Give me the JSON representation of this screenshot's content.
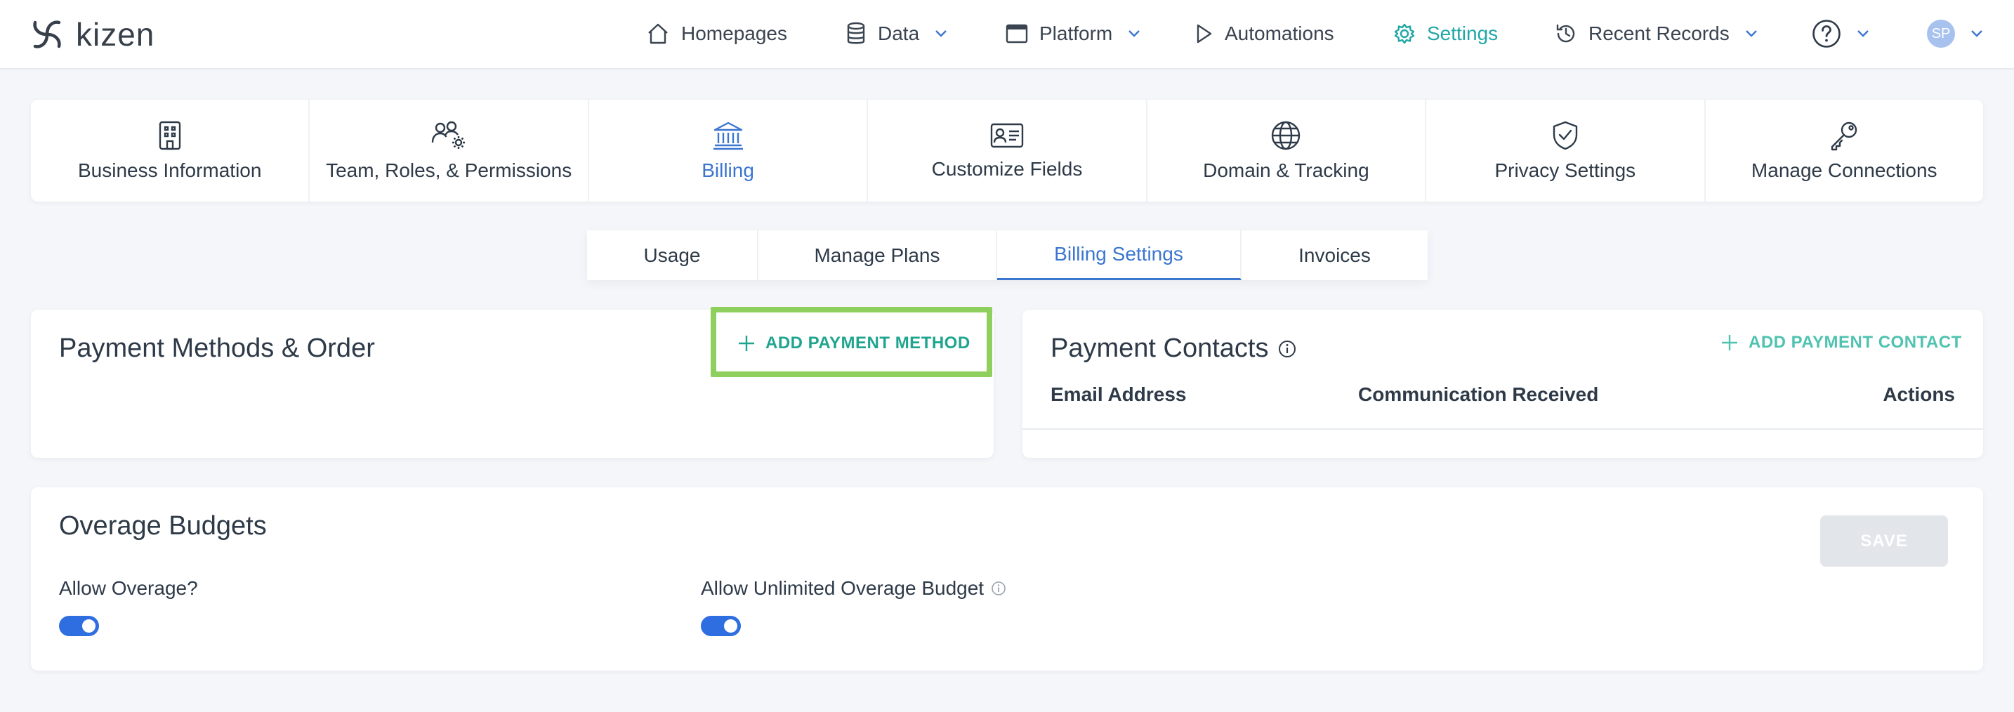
{
  "brand": {
    "logo_text": "kizen"
  },
  "nav": {
    "homepages": "Homepages",
    "data": "Data",
    "platform": "Platform",
    "automations": "Automations",
    "settings": "Settings",
    "recent_records": "Recent Records",
    "avatar_initials": "SP"
  },
  "settings_cards": [
    {
      "label": "Business Information",
      "icon": "building-icon"
    },
    {
      "label": "Team, Roles, & Permissions",
      "icon": "team-gear-icon"
    },
    {
      "label": "Billing",
      "icon": "bank-icon",
      "active": true
    },
    {
      "label": "Customize Fields",
      "icon": "id-card-icon"
    },
    {
      "label": "Domain & Tracking",
      "icon": "globe-icon"
    },
    {
      "label": "Privacy Settings",
      "icon": "shield-check-icon"
    },
    {
      "label": "Manage Connections",
      "icon": "key-icon"
    }
  ],
  "subtabs": [
    {
      "label": "Usage"
    },
    {
      "label": "Manage Plans"
    },
    {
      "label": "Billing Settings",
      "active": true
    },
    {
      "label": "Invoices"
    }
  ],
  "payment_methods": {
    "title": "Payment Methods & Order",
    "add_label": "ADD PAYMENT METHOD"
  },
  "payment_contacts": {
    "title": "Payment Contacts",
    "add_label": "ADD PAYMENT CONTACT",
    "columns": [
      "Email Address",
      "Communication Received",
      "Actions"
    ]
  },
  "overage": {
    "title": "Overage Budgets",
    "allow_overage_label": "Allow Overage?",
    "allow_overage": true,
    "allow_unlimited_label": "Allow Unlimited Overage Budget",
    "allow_unlimited": true,
    "save_label": "SAVE"
  },
  "colors": {
    "accent_teal": "#21a7a6",
    "accent_blue": "#3b76cf",
    "toggle_blue": "#2f6ee0",
    "highlight_green": "#8fcf5e"
  }
}
